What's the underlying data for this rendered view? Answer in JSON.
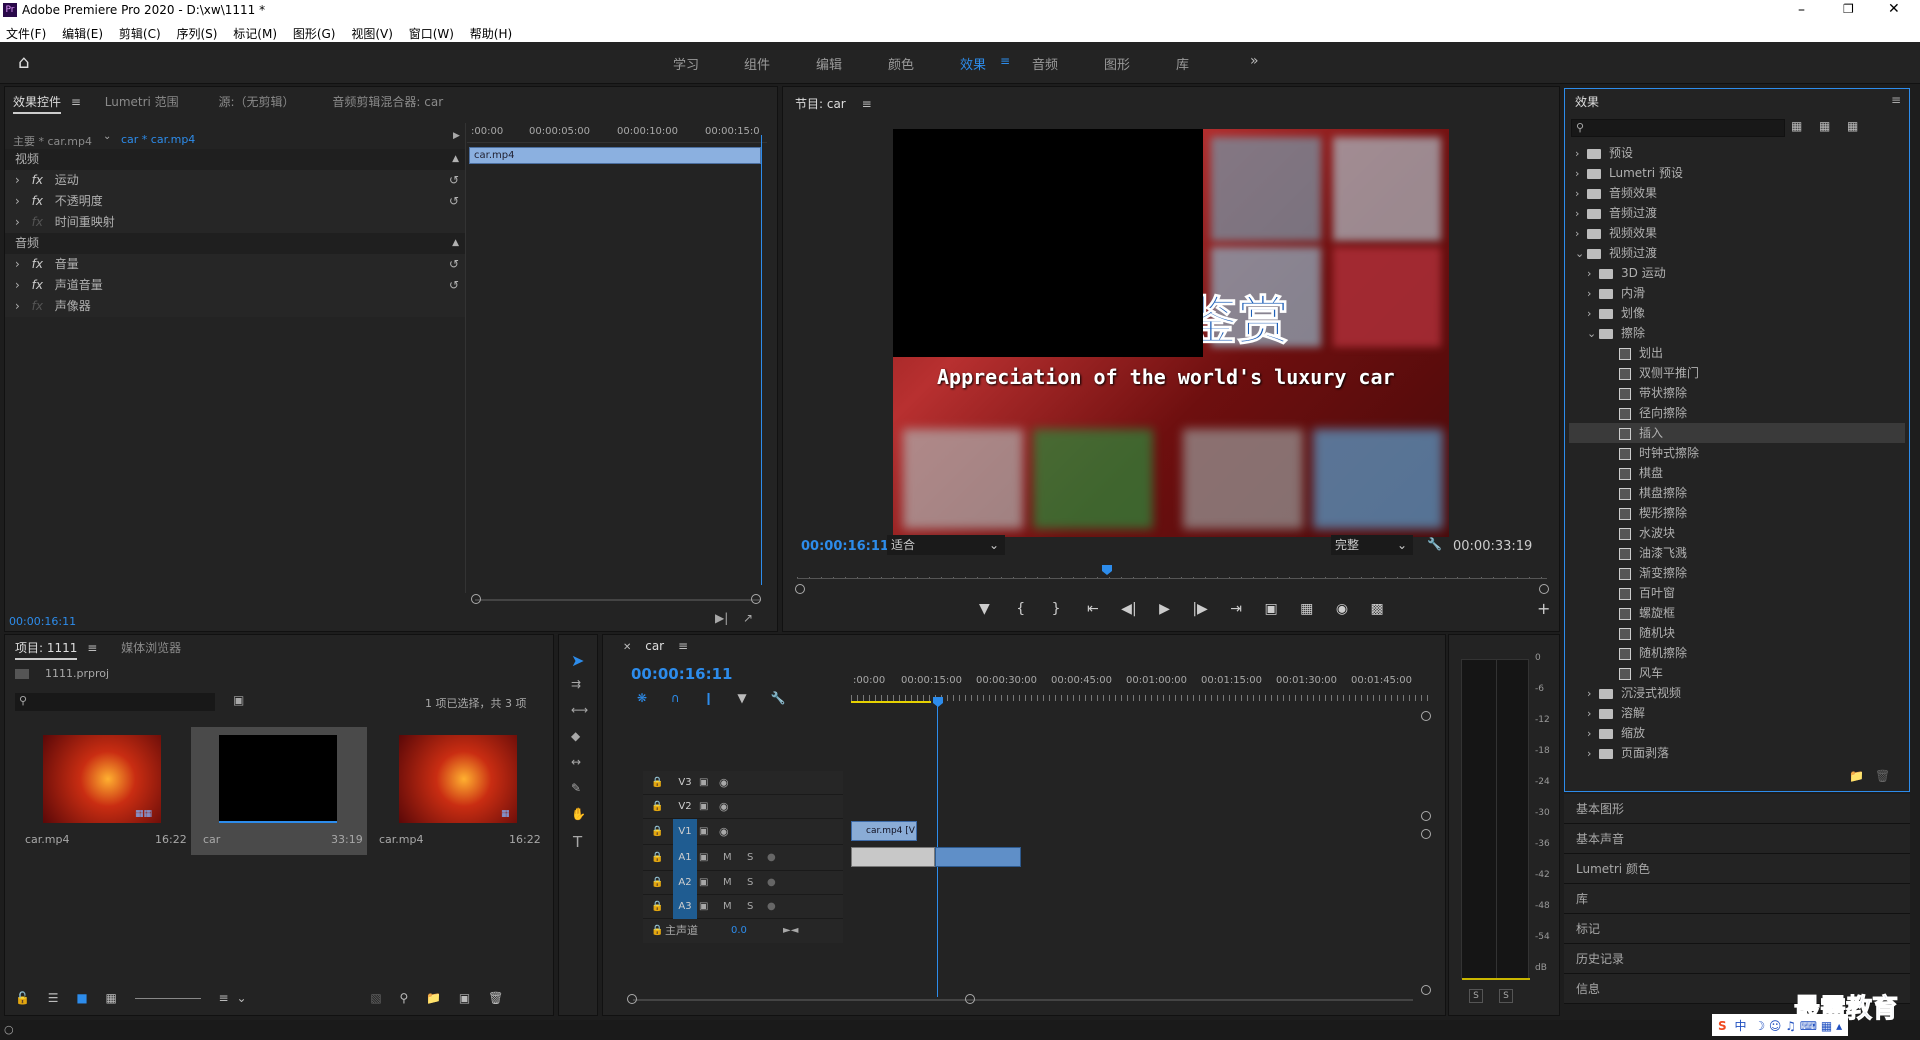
{
  "app": {
    "title": "Adobe Premiere Pro 2020 - D:\\xw\\1111 *",
    "menu": [
      "文件(F)",
      "编辑(E)",
      "剪辑(C)",
      "序列(S)",
      "标记(M)",
      "图形(G)",
      "视图(V)",
      "窗口(W)",
      "帮助(H)"
    ],
    "workspaces": [
      "学习",
      "组件",
      "编辑",
      "颜色",
      "效果",
      "音频",
      "图形",
      "库"
    ],
    "active_workspace": "效果"
  },
  "effect_controls": {
    "tabs": [
      "效果控件",
      "Lumetri 范围",
      "源:（无剪辑）",
      "音频剪辑混合器: car"
    ],
    "master": "主要 * car.mp4",
    "clip": "car * car.mp4",
    "ruler": [
      ":00:00",
      "00:00:05:00",
      "00:00:10:00",
      "00:00:15:0"
    ],
    "clip_bar": "car.mp4",
    "video_header": "视频",
    "video_items": [
      "运动",
      "不透明度",
      "时间重映射"
    ],
    "audio_header": "音频",
    "audio_items": [
      "音量",
      "声道音量",
      "声像器"
    ],
    "timecode": "00:00:16:11"
  },
  "program": {
    "title": "节目: car",
    "timecode": "00:00:16:11",
    "fit": "适合",
    "quality": "完整",
    "duration": "00:00:33:19",
    "overlay_title": "车鉴赏",
    "overlay_sub": "Appreciation of the world's luxury car"
  },
  "effects": {
    "title": "效果",
    "tree": [
      {
        "label": "预设",
        "level": 0,
        "type": "folder"
      },
      {
        "label": "Lumetri 预设",
        "level": 0,
        "type": "folder"
      },
      {
        "label": "音频效果",
        "level": 0,
        "type": "folder"
      },
      {
        "label": "音频过渡",
        "level": 0,
        "type": "folder"
      },
      {
        "label": "视频效果",
        "level": 0,
        "type": "folder"
      },
      {
        "label": "视频过渡",
        "level": 0,
        "type": "folder",
        "open": true
      },
      {
        "label": "3D 运动",
        "level": 1,
        "type": "folder"
      },
      {
        "label": "内滑",
        "level": 1,
        "type": "folder"
      },
      {
        "label": "划像",
        "level": 1,
        "type": "folder"
      },
      {
        "label": "擦除",
        "level": 1,
        "type": "folder",
        "open": true
      },
      {
        "label": "划出",
        "level": 2,
        "type": "fx"
      },
      {
        "label": "双侧平推门",
        "level": 2,
        "type": "fx"
      },
      {
        "label": "带状擦除",
        "level": 2,
        "type": "fx"
      },
      {
        "label": "径向擦除",
        "level": 2,
        "type": "fx"
      },
      {
        "label": "插入",
        "level": 2,
        "type": "fx",
        "selected": true
      },
      {
        "label": "时钟式擦除",
        "level": 2,
        "type": "fx"
      },
      {
        "label": "棋盘",
        "level": 2,
        "type": "fx"
      },
      {
        "label": "棋盘擦除",
        "level": 2,
        "type": "fx"
      },
      {
        "label": "楔形擦除",
        "level": 2,
        "type": "fx"
      },
      {
        "label": "水波块",
        "level": 2,
        "type": "fx"
      },
      {
        "label": "油漆飞溅",
        "level": 2,
        "type": "fx"
      },
      {
        "label": "渐变擦除",
        "level": 2,
        "type": "fx"
      },
      {
        "label": "百叶窗",
        "level": 2,
        "type": "fx"
      },
      {
        "label": "螺旋框",
        "level": 2,
        "type": "fx"
      },
      {
        "label": "随机块",
        "level": 2,
        "type": "fx"
      },
      {
        "label": "随机擦除",
        "level": 2,
        "type": "fx"
      },
      {
        "label": "风车",
        "level": 2,
        "type": "fx"
      },
      {
        "label": "沉浸式视频",
        "level": 1,
        "type": "folder"
      },
      {
        "label": "溶解",
        "level": 1,
        "type": "folder"
      },
      {
        "label": "缩放",
        "level": 1,
        "type": "folder"
      },
      {
        "label": "页面剥落",
        "level": 1,
        "type": "folder"
      }
    ],
    "collapsed_panels": [
      "基本图形",
      "基本声音",
      "Lumetri 颜色",
      "库",
      "标记",
      "历史记录",
      "信息"
    ]
  },
  "project": {
    "tabs": [
      "项目: 1111",
      "媒体浏览器"
    ],
    "file": "1111.prproj",
    "selection": "1 项已选择，共 3 项",
    "items": [
      {
        "name": "car.mp4",
        "duration": "16:22",
        "kind": "red"
      },
      {
        "name": "car",
        "duration": "33:19",
        "kind": "black",
        "selected": true
      },
      {
        "name": "car.mp4",
        "duration": "16:22",
        "kind": "red"
      }
    ]
  },
  "timeline": {
    "name": "car",
    "timecode": "00:00:16:11",
    "ruler": [
      ":00:00",
      "00:00:15:00",
      "00:00:30:00",
      "00:00:45:00",
      "00:01:00:00",
      "00:01:15:00",
      "00:01:30:00",
      "00:01:45:00"
    ],
    "tracks": [
      "V3",
      "V2",
      "V1",
      "A1",
      "A2",
      "A3"
    ],
    "master_label": "主声道",
    "master_value": "0.0",
    "clip_label": "car.mp4 [V"
  },
  "meter": {
    "scale": [
      "0",
      "-6",
      "-12",
      "-18",
      "-24",
      "-30",
      "-36",
      "-42",
      "-48",
      "-54",
      "dB"
    ],
    "solo": [
      "S",
      "S"
    ]
  },
  "watermark": "最需教育",
  "ime": "中"
}
